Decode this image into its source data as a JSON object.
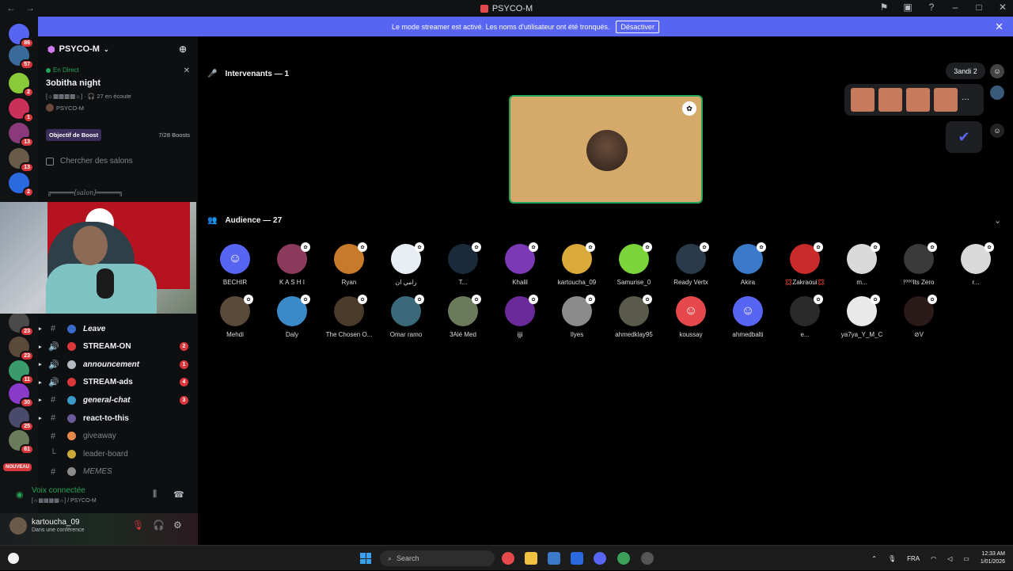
{
  "window": {
    "title": "PSYCO-M"
  },
  "banner": {
    "message": "Le mode streamer est activé. Les noms d'utilisateur ont été tronqués.",
    "button": "Désactiver"
  },
  "guilds": [
    {
      "badge": "86"
    },
    {
      "badge": "57"
    },
    {
      "badge": "2"
    },
    {
      "badge": "1"
    },
    {
      "badge": "13"
    },
    {
      "badge": "13"
    },
    {
      "badge": "2"
    },
    {
      "badge": "23"
    },
    {
      "badge": "23"
    },
    {
      "badge": "11"
    },
    {
      "badge": "30"
    },
    {
      "badge": "25"
    },
    {
      "badge": "61"
    }
  ],
  "guild_new": "NOUVEAU",
  "server": {
    "name": "PSYCO-M"
  },
  "live": {
    "status": "En Direct",
    "name": "3obitha night",
    "listeners": "[☼▩▩▩▩☼] · 🎧 27 en écoute",
    "host": "PSYCO-M"
  },
  "boost": {
    "label": "Objectif de Boost",
    "count": "7/28 Boosts"
  },
  "search": {
    "placeholder": "Chercher des salons"
  },
  "category": "╔══════[salon]══════╗",
  "channels": [
    {
      "label": "Leave",
      "badge": ""
    },
    {
      "label": "STREAM-ON",
      "badge": "2"
    },
    {
      "label": "announcement",
      "badge": "1"
    },
    {
      "label": "STREAM-ads",
      "badge": "4"
    },
    {
      "label": "general-chat",
      "badge": "3"
    },
    {
      "label": "react-to-this",
      "badge": ""
    },
    {
      "label": "giveaway",
      "badge": ""
    },
    {
      "label": "leader-board",
      "badge": ""
    },
    {
      "label": "MEMES",
      "badge": ""
    }
  ],
  "voice": {
    "status": "Voix connectée",
    "channel": "[☼▩▩▩▩☼] / PSYCO-M"
  },
  "user": {
    "name": "kartoucha_09",
    "status": "Dans une conférence"
  },
  "stage": {
    "speakers_header": "Intervenants — 1",
    "audience_header": "Audience — 27"
  },
  "right_panel": {
    "label": "3andi 2"
  },
  "audience": [
    {
      "name": "BECHIR",
      "color": "#5865f2"
    },
    {
      "name": "K A S H I",
      "color": "#8a3a5a"
    },
    {
      "name": "Ryan",
      "color": "#c77b2a"
    },
    {
      "name": "رامي ان",
      "color": "#e9eef5"
    },
    {
      "name": "T...",
      "color": "#1a2a3a"
    },
    {
      "name": "Khalil",
      "color": "#7a3ab5"
    },
    {
      "name": "kartoucha_09",
      "color": "#d9a93a"
    },
    {
      "name": "Samurise_0",
      "color": "#7ad43a"
    },
    {
      "name": "Ready Vertx",
      "color": "#2a3a4a"
    },
    {
      "name": "Akira",
      "color": "#3a7ac9"
    },
    {
      "name": "💢Zakraoui💢",
      "color": "#c92a2a"
    },
    {
      "name": "m...",
      "color": "#d9d9d9"
    },
    {
      "name": "!⁰⁰⁰Its Zero",
      "color": "#3a3a3a"
    },
    {
      "name": "r...",
      "color": "#d9d9d9"
    },
    {
      "name": "Mehdi",
      "color": "#5a4a3a"
    },
    {
      "name": "Daly",
      "color": "#3a8ac9"
    },
    {
      "name": "The Chosen O...",
      "color": "#4a3a2a"
    },
    {
      "name": "Omar ramo",
      "color": "#3a6a7a"
    },
    {
      "name": "3Alé Med",
      "color": "#6a7a5a"
    },
    {
      "name": "ijji",
      "color": "#6a2a9a"
    },
    {
      "name": "Ilyes",
      "color": "#8a8a8a"
    },
    {
      "name": "ahmedklay95",
      "color": "#5a5a4a"
    },
    {
      "name": "koussay",
      "color": "#e5494b"
    },
    {
      "name": "ahmedbalti",
      "color": "#5865f2"
    },
    {
      "name": "e...",
      "color": "#2a2a2a"
    },
    {
      "name": "ya7ya_Y_M_C",
      "color": "#e9e9e9"
    },
    {
      "name": "⊘V",
      "color": "#2a1a1a"
    }
  ],
  "taskbar": {
    "search": "Search",
    "lang": "FRA",
    "time": "12:33 AM",
    "date": "1/01/2026"
  }
}
